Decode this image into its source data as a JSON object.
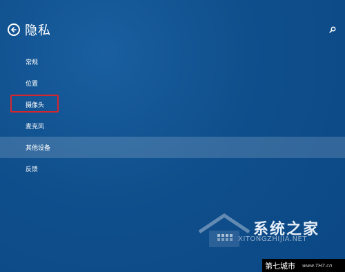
{
  "header": {
    "title": "隐私",
    "back_icon": "back-arrow-circle-icon",
    "search_icon": "search-icon"
  },
  "nav": {
    "items": [
      {
        "label": "常规",
        "selected": false
      },
      {
        "label": "位置",
        "selected": false
      },
      {
        "label": "摄像头",
        "selected": false,
        "highlighted": true
      },
      {
        "label": "麦克风",
        "selected": false
      },
      {
        "label": "其他设备",
        "selected": true
      },
      {
        "label": "反馈",
        "selected": false
      }
    ]
  },
  "watermark": {
    "title": "系统之家",
    "subtitle": "XITONGZHIJIA.NET"
  },
  "corner_badge": {
    "cn": "第七城市",
    "en": "www.TH7.cn"
  },
  "colors": {
    "background": "#0f4f8c",
    "selected_row": "rgba(255,255,255,0.16)",
    "highlight_border": "#d4262e"
  }
}
